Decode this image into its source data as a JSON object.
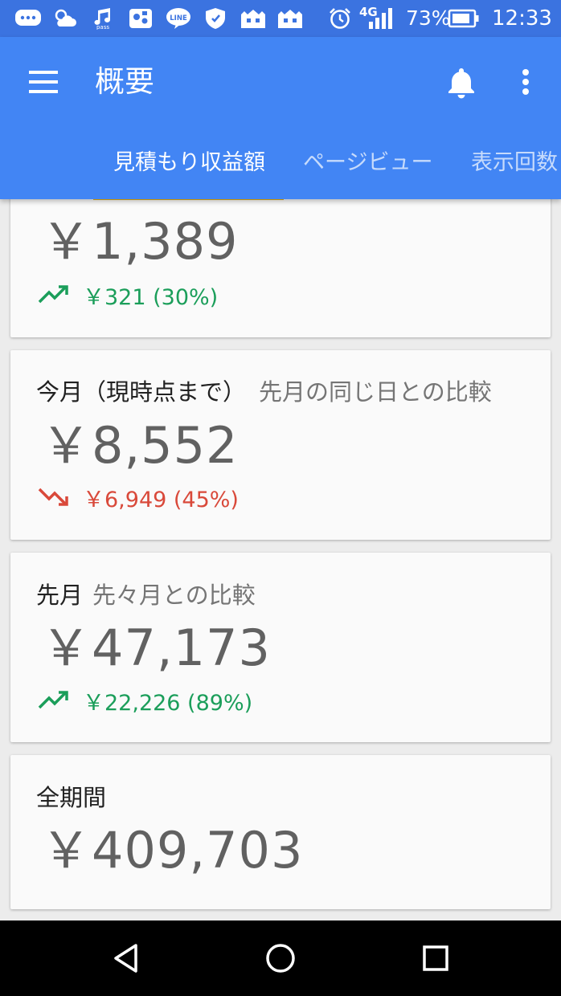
{
  "status_bar": {
    "network": "4G",
    "battery": "73%",
    "time": "12:33",
    "icons": [
      "chat-icon",
      "weather-icon",
      "music-pass-icon",
      "game-icon",
      "line-icon",
      "shield-icon",
      "castle-icon",
      "castle-icon",
      "alarm-icon",
      "signal-icon",
      "battery-icon"
    ]
  },
  "app_bar": {
    "title": "概要",
    "tabs": [
      {
        "label": "見積もり収益額",
        "active": true
      },
      {
        "label": "ページビュー",
        "active": false
      },
      {
        "label": "表示回数",
        "active": false
      }
    ],
    "accent_color": "#4285f4",
    "indicator_color": "#f4b400"
  },
  "cards": [
    {
      "amount": "￥1,389",
      "change": {
        "direction": "up",
        "text": "￥321 (30%)",
        "color": "#1b9e5a"
      }
    },
    {
      "title": "今月（現時点まで）",
      "subtitle": "先月の同じ日との比較",
      "amount": "￥8,552",
      "change": {
        "direction": "down",
        "text": "￥6,949 (45%)",
        "color": "#d9493a"
      }
    },
    {
      "title": "先月",
      "subtitle": "先々月との比較",
      "amount": "￥47,173",
      "change": {
        "direction": "up",
        "text": "￥22,226 (89%)",
        "color": "#1b9e5a"
      }
    },
    {
      "title": "全期間",
      "amount": "￥409,703"
    }
  ],
  "nav_bar": {
    "icons": [
      "back-icon",
      "home-icon",
      "recents-icon"
    ]
  }
}
